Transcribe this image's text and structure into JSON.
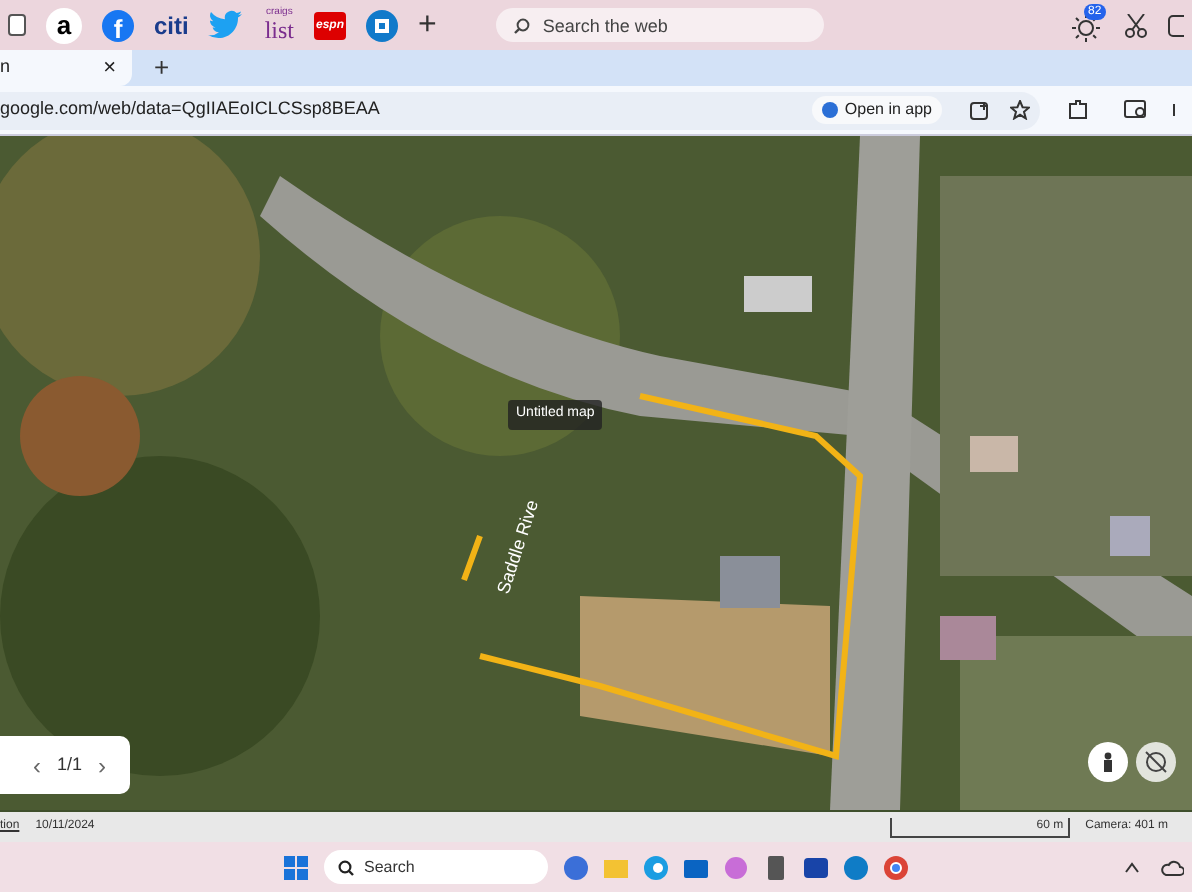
{
  "bookmarks_bar": {
    "bookmarks": [
      {
        "kind": "amazon",
        "label": "a"
      },
      {
        "kind": "facebook",
        "label": "f"
      },
      {
        "kind": "citi",
        "label": "citi"
      },
      {
        "kind": "twitter"
      },
      {
        "kind": "craigslist",
        "label": "list",
        "sublabel": "craigs"
      },
      {
        "kind": "espn",
        "label": "espn"
      },
      {
        "kind": "chase"
      }
    ],
    "add": "+",
    "search": {
      "placeholder": "Search the web"
    },
    "notification_count": "82"
  },
  "tabs": [
    {
      "label": "n",
      "close": "×",
      "selected": true
    }
  ],
  "new_tab": "+",
  "address_bar": {
    "url": "google.com/web/data=QgIIAEoICLCSsp8BEAA",
    "open_in_app": "Open in app"
  },
  "map": {
    "title_label": "Untitled map",
    "road_label": "Saddle Rive",
    "pager": {
      "prev": "‹",
      "page": "1/1",
      "next": "›"
    }
  },
  "status_bar": {
    "link": "tion",
    "date": "10/11/2024",
    "scale": "60 m",
    "camera": "Camera: 401 m"
  },
  "taskbar": {
    "search": {
      "placeholder": "Search"
    }
  }
}
